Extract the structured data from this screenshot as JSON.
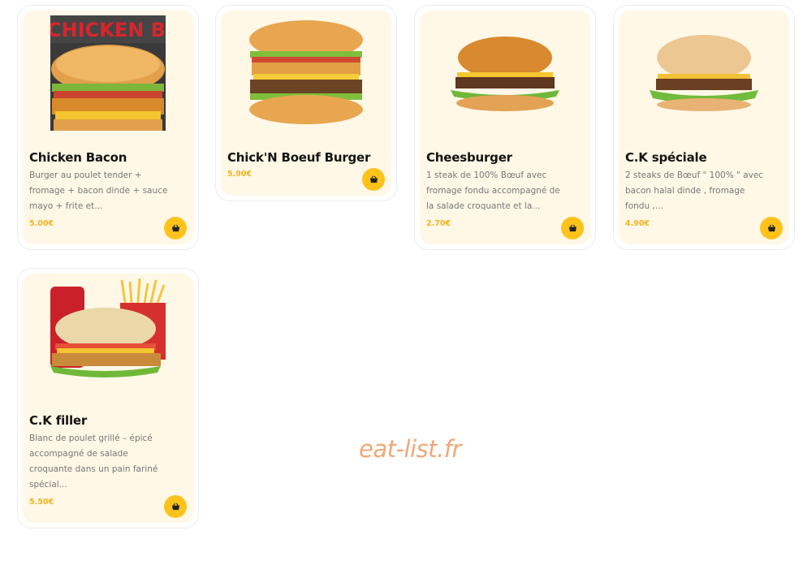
{
  "products": [
    {
      "name": "Chicken Bacon",
      "description": "Burger au poulet tender + fromage + bacon dinde + sauce mayo + frite et...",
      "price": "5.00€",
      "image_banner_text": "CHICKEN BACO",
      "image": "chicken-burger-image"
    },
    {
      "name": "Chick'N Boeuf Burger",
      "description": "",
      "price": "5.90€",
      "image": "chick-n-boeuf-burger-image"
    },
    {
      "name": "Cheesburger",
      "description": "1 steak de 100% Bœuf avec fromage fondu accompagné de la salade croquante et la...",
      "price": "2.70€",
      "image": "cheeseburger-image"
    },
    {
      "name": "C.K spéciale",
      "description": "2 steaks de Bœuf \" 100% \" avec bacon halal dinde , fromage fondu ,...",
      "price": "4.90€",
      "image": "ck-speciale-burger-image"
    },
    {
      "name": "C.K filler",
      "description": "Blanc de poulet grillé – épicé accompagné de salade croquante dans un pain fariné spécial...",
      "price": "5.50€",
      "image": "ck-filler-menu-image"
    }
  ],
  "watermark": "eat-list.fr",
  "colors": {
    "card_background": "#fff8e6",
    "price": "#f2b322",
    "basket_button": "#ffc21a",
    "watermark": "#f0a878"
  },
  "icons": {
    "basket": "basket-icon"
  }
}
